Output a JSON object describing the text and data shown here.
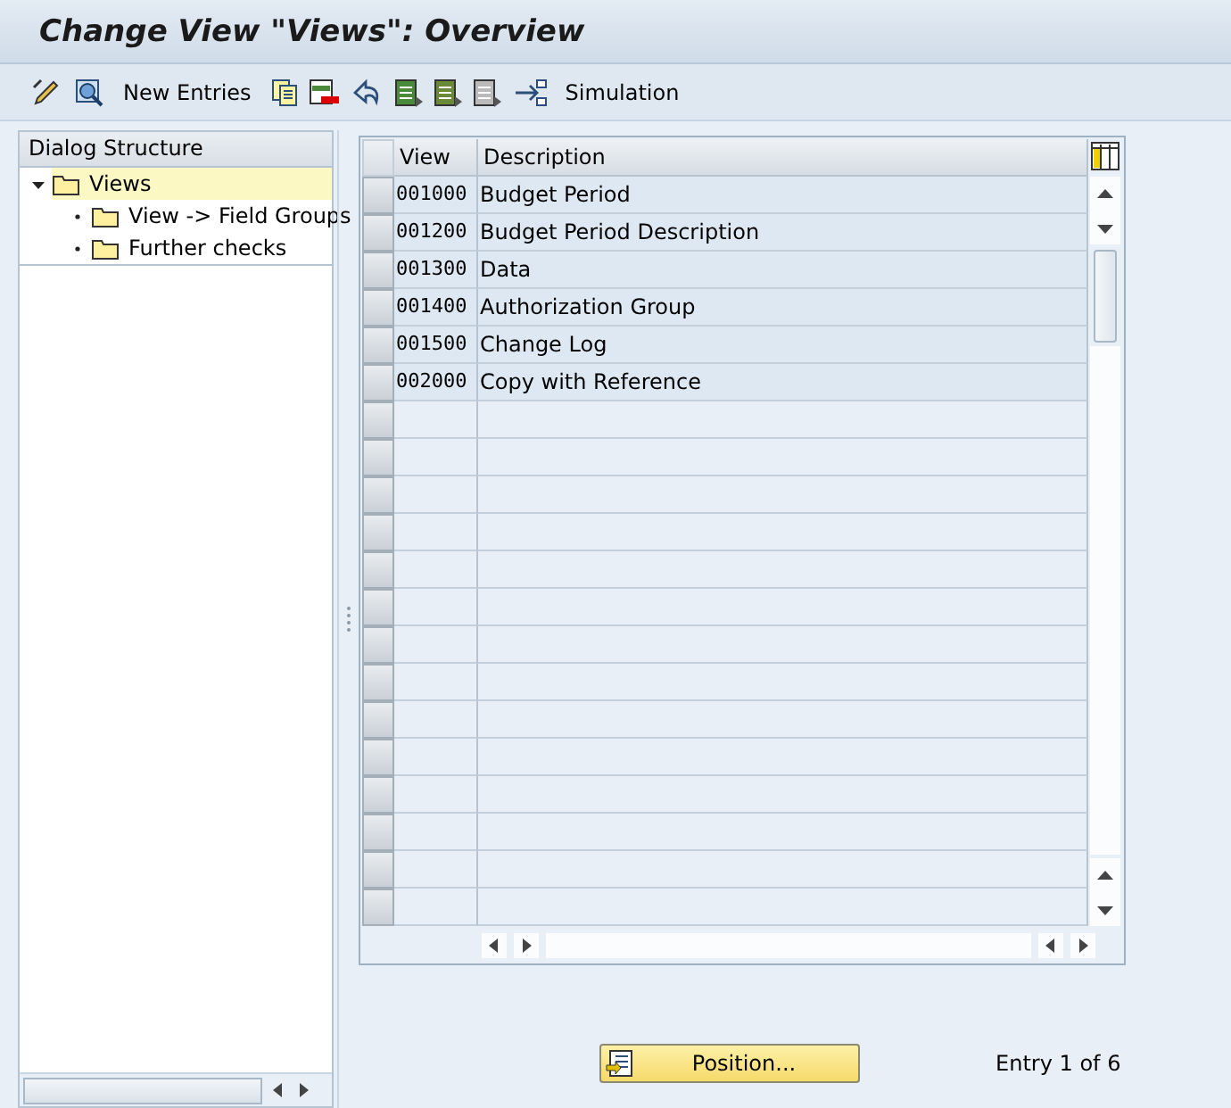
{
  "window": {
    "title": "Change View \"Views\": Overview"
  },
  "toolbar": [
    {
      "label": "New Entries"
    },
    {
      "label": "Simulation"
    }
  ],
  "dialog_structure": {
    "title": "Dialog Structure",
    "items": [
      {
        "label": "Views",
        "selected": true,
        "expanded": true,
        "children": [
          {
            "label": "View -> Field Groups",
            "selected": false
          },
          {
            "label": "Further checks",
            "selected": false
          }
        ]
      }
    ]
  },
  "table": {
    "columns": [
      "View",
      "Description"
    ],
    "rows": [
      {
        "cells": [
          "001000",
          "Budget Period"
        ]
      },
      {
        "cells": [
          "001200",
          "Budget Period Description"
        ]
      },
      {
        "cells": [
          "001300",
          "Data"
        ]
      },
      {
        "cells": [
          "001400",
          "Authorization Group"
        ]
      },
      {
        "cells": [
          "001500",
          "Change Log"
        ]
      },
      {
        "cells": [
          "002000",
          "Copy with Reference"
        ]
      }
    ]
  },
  "position_button": "Position...",
  "entry_info": "Entry 1 of 6"
}
